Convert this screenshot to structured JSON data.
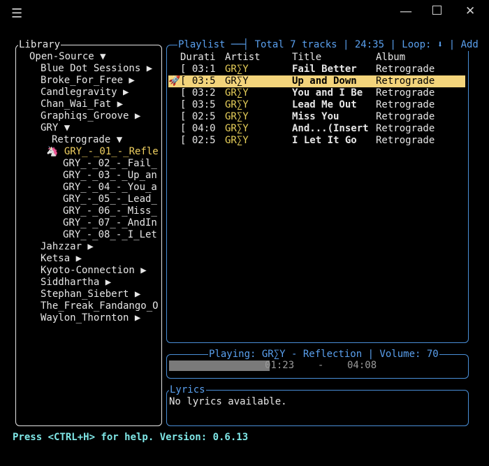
{
  "window": {
    "menu_glyph": "☰",
    "minimize_glyph": "—",
    "close_glyph": "✕"
  },
  "library": {
    "title": "Library",
    "tree": [
      {
        "text": "Open-Source ▼",
        "indent": 1,
        "color": "#e6e6e6"
      },
      {
        "text": "Blue Dot Sessions ▶",
        "indent": 2,
        "color": "#e6e6e6"
      },
      {
        "text": "Broke_For_Free ▶",
        "indent": 2,
        "color": "#e6e6e6"
      },
      {
        "text": "Candlegravity ▶",
        "indent": 2,
        "color": "#e6e6e6"
      },
      {
        "text": "Chan_Wai_Fat ▶",
        "indent": 2,
        "color": "#e6e6e6"
      },
      {
        "text": "Graphiqs_Groove ▶",
        "indent": 2,
        "color": "#e6e6e6"
      },
      {
        "text": "GRY ▼",
        "indent": 2,
        "color": "#e6e6e6"
      },
      {
        "text": "Retrograde ▼",
        "indent": 3,
        "color": "#e6e6e6"
      },
      {
        "text": "🦄 GRY_-_01_-_Refle",
        "indent": 3,
        "color": "#f0d060",
        "current": true
      },
      {
        "text": "GRY_-_02_-_Fail_",
        "indent": 4,
        "color": "#e6e6e6"
      },
      {
        "text": "GRY_-_03_-_Up_an",
        "indent": 4,
        "color": "#e6e6e6"
      },
      {
        "text": "GRY_-_04_-_You_a",
        "indent": 4,
        "color": "#e6e6e6"
      },
      {
        "text": "GRY_-_05_-_Lead_",
        "indent": 4,
        "color": "#e6e6e6"
      },
      {
        "text": "GRY_-_06_-_Miss_",
        "indent": 4,
        "color": "#e6e6e6"
      },
      {
        "text": "GRY_-_07_-_AndIn",
        "indent": 4,
        "color": "#e6e6e6"
      },
      {
        "text": "GRY_-_08_-_I_Let",
        "indent": 4,
        "color": "#e6e6e6"
      },
      {
        "text": "Jahzzar ▶",
        "indent": 2,
        "color": "#e6e6e6"
      },
      {
        "text": "Ketsa ▶",
        "indent": 2,
        "color": "#e6e6e6"
      },
      {
        "text": "Kyoto-Connection ▶",
        "indent": 2,
        "color": "#e6e6e6"
      },
      {
        "text": "Siddhartha ▶",
        "indent": 2,
        "color": "#e6e6e6"
      },
      {
        "text": "Stephan_Siebert ▶",
        "indent": 2,
        "color": "#e6e6e6"
      },
      {
        "text": "The_Freak_Fandango_O",
        "indent": 2,
        "color": "#e6e6e6"
      },
      {
        "text": "Waylon_Thornton ▶",
        "indent": 2,
        "color": "#e6e6e6"
      }
    ]
  },
  "playlist": {
    "title": "Playlist ──┤ Total 7 tracks | 24:35 | Loop: ⬇ | Add",
    "columns": {
      "duration": "Durati",
      "artist": "Artist",
      "title": "Title",
      "album": "Album"
    },
    "rows": [
      {
        "marker": "",
        "duration": "[ 03:1",
        "artist": "GR∑Y",
        "title": "Fail Better",
        "album": "Retrograde",
        "selected": false
      },
      {
        "marker": "🚀",
        "duration": "[ 03:5",
        "artist": "GR∑Y",
        "title": "Up and Down",
        "album": "Retrograde",
        "selected": true
      },
      {
        "marker": "",
        "duration": "[ 03:2",
        "artist": "GR∑Y",
        "title": "You and I Be",
        "album": "Retrograde",
        "selected": false
      },
      {
        "marker": "",
        "duration": "[ 03:5",
        "artist": "GR∑Y",
        "title": "Lead Me Out",
        "album": "Retrograde",
        "selected": false
      },
      {
        "marker": "",
        "duration": "[ 02:5",
        "artist": "GR∑Y",
        "title": "Miss You",
        "album": "Retrograde",
        "selected": false
      },
      {
        "marker": "",
        "duration": "[ 04:0",
        "artist": "GR∑Y",
        "title": "And...(Insert",
        "album": "Retrograde",
        "selected": false
      },
      {
        "marker": "",
        "duration": "[ 02:5",
        "artist": "GR∑Y",
        "title": "I Let It Go",
        "album": "Retrograde",
        "selected": false
      }
    ],
    "accent": "#4a8fd8",
    "selection_color": "#f3d47b"
  },
  "status": {
    "title": "Playing: GR∑Y - Reflection | Volume: 70",
    "progress_text": "01:23    -    04:08",
    "progress_fraction": 0.338
  },
  "lyrics": {
    "title": "Lyrics",
    "body": "No lyrics available."
  },
  "footer": {
    "text": "Press <CTRL+H> for help. Version: 0.6.13"
  }
}
